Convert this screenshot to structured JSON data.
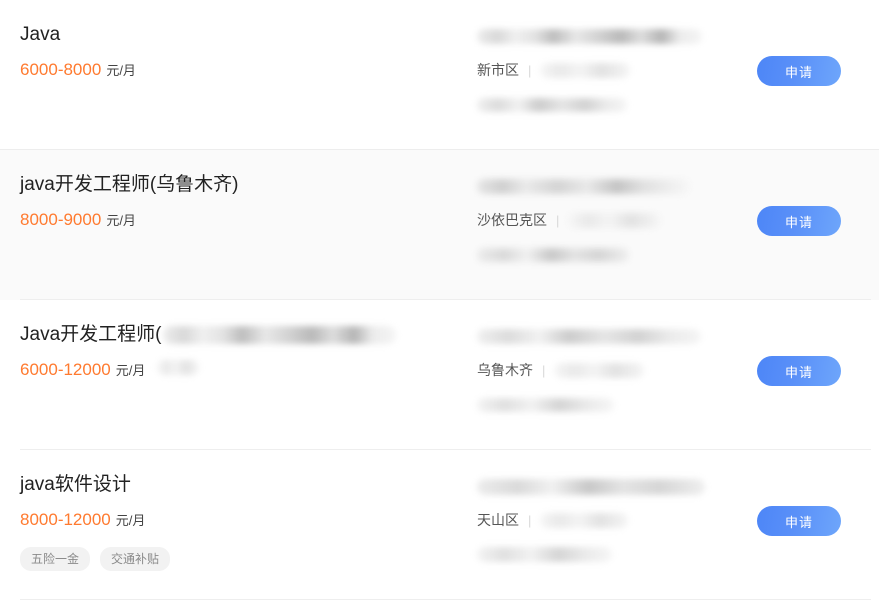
{
  "list": {
    "apply_label": "申请",
    "separator": "|",
    "jobs": [
      {
        "title": "Java",
        "salary": "6000-8000",
        "salary_unit": "元/月",
        "district": "新市区",
        "tags": [],
        "title_redacted": false,
        "salary_tag_redacted": false,
        "alt_background": false
      },
      {
        "title": "java开发工程师(乌鲁木齐)",
        "salary": "8000-9000",
        "salary_unit": "元/月",
        "district": "沙依巴克区",
        "tags": [],
        "title_redacted": false,
        "salary_tag_redacted": false,
        "alt_background": true
      },
      {
        "title": "Java开发工程师(",
        "salary": "6000-12000",
        "salary_unit": "元/月",
        "district": "乌鲁木齐",
        "tags": [],
        "title_redacted": true,
        "salary_tag_redacted": true,
        "alt_background": false
      },
      {
        "title": "java软件设计",
        "salary": "8000-12000",
        "salary_unit": "元/月",
        "district": "天山区",
        "tags": [
          "五险一金",
          "交通补贴"
        ],
        "title_redacted": false,
        "salary_tag_redacted": false,
        "alt_background": false
      }
    ]
  },
  "colors": {
    "salary": "#ff7a2f",
    "apply_button": "#4d86f7",
    "title": "#222222",
    "district": "#555555",
    "tag_background": "#f2f2f2",
    "row_alt_background": "#fafafa",
    "divider": "#ededed"
  }
}
